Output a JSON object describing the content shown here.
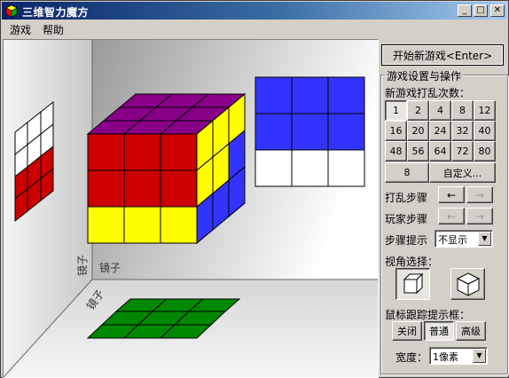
{
  "window": {
    "title": "三维智力魔方"
  },
  "menu": {
    "items": [
      "游戏",
      "帮助"
    ]
  },
  "viewport": {
    "mirror_label_1": "镜子",
    "mirror_label_2": "镜子"
  },
  "panel": {
    "new_game_button": "开始新游戏<Enter>",
    "group_title": "游戏设置与操作",
    "scramble_label": "新游戏打乱次数：",
    "scramble_options": [
      "1",
      "2",
      "4",
      "8",
      "12",
      "16",
      "20",
      "24",
      "32",
      "40",
      "48",
      "56",
      "64",
      "72",
      "80",
      "8",
      "自定义..."
    ],
    "scramble_selected": "1",
    "scramble_steps_label": "打乱步骤",
    "player_steps_label": "玩家步骤",
    "arrow_left": "←",
    "arrow_right": "→",
    "hint_label": "步骤提示",
    "hint_value": "不显示",
    "view_label": "视角选择：",
    "tracking_label": "鼠标跟踪提示框：",
    "tracking_options": [
      "关闭",
      "普通",
      "高级"
    ],
    "tracking_selected": "普通",
    "width_label": "宽度：",
    "width_value": "1像素"
  },
  "colors": {
    "red": "#cc0000",
    "yellow": "#ffff00",
    "blue": "#3333ff",
    "purple": "#880088",
    "green": "#008800",
    "white": "#ffffff"
  }
}
